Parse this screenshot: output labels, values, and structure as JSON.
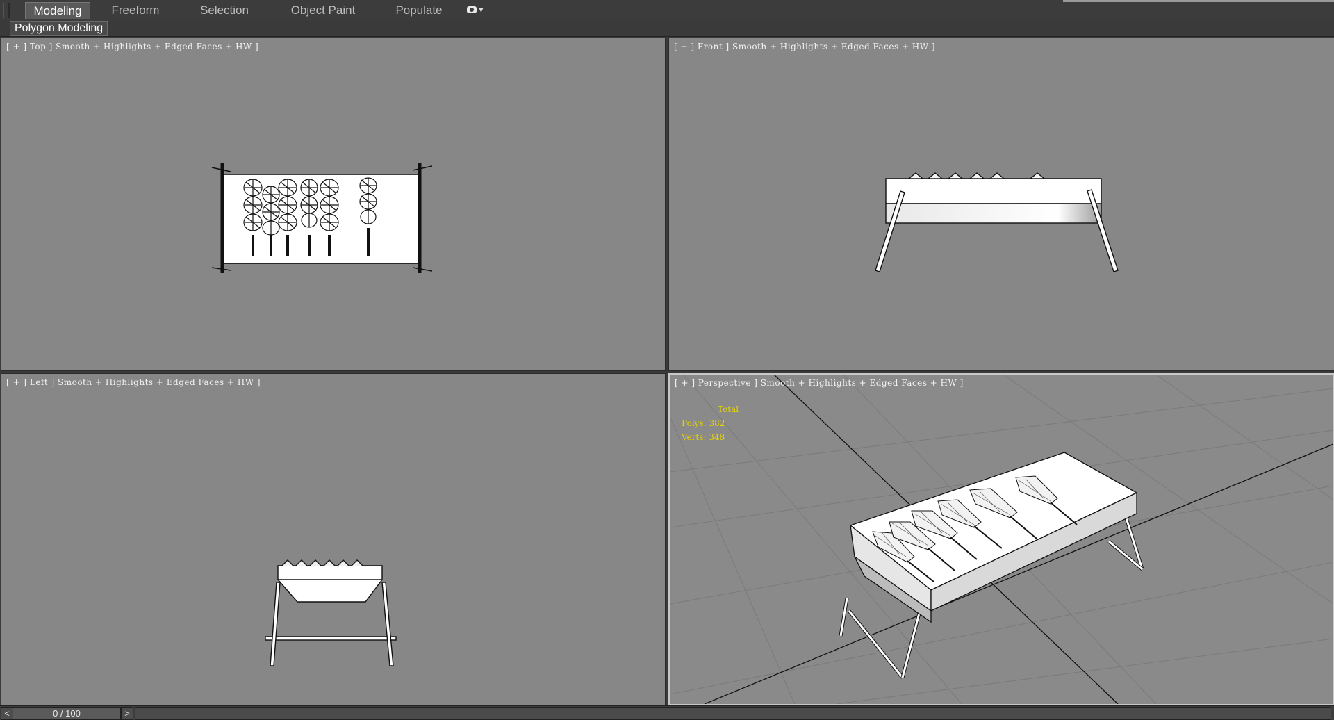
{
  "ribbon": {
    "tabs": [
      {
        "label": "Modeling",
        "active": true
      },
      {
        "label": "Freeform",
        "active": false
      },
      {
        "label": "Selection",
        "active": false
      },
      {
        "label": "Object Paint",
        "active": false
      },
      {
        "label": "Populate",
        "active": false
      }
    ],
    "panel": "Polygon Modeling"
  },
  "viewports": {
    "top": {
      "label": "[ + ] Top ] Smooth + Highlights + Edged Faces + HW ]"
    },
    "front": {
      "label": "[ + ] Front ] Smooth + Highlights + Edged Faces + HW ]"
    },
    "left": {
      "label": "[ + ] Left ] Smooth + Highlights + Edged Faces + HW ]"
    },
    "perspective": {
      "label": "[ + ] Perspective ] Smooth + Highlights + Edged Faces + HW ]"
    }
  },
  "stats": {
    "title": "Total",
    "polys": "Polys: 382",
    "verts": "Verts: 348"
  },
  "timeline": {
    "frame": "0 / 100",
    "prev": "<",
    "next": ">"
  },
  "colors": {
    "viewport_bg": "#878787",
    "stats_text": "#e8d300",
    "active_border": "#c8c8c8"
  }
}
